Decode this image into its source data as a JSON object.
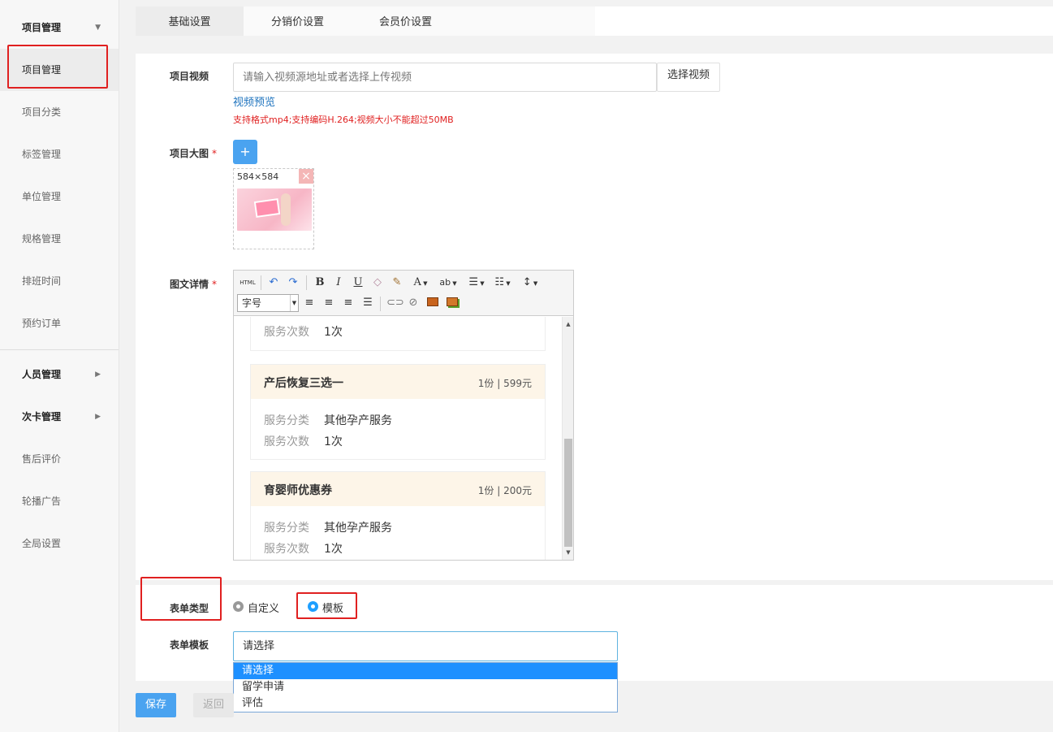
{
  "sidebar": {
    "group1": "项目管理",
    "items": [
      "项目管理",
      "项目分类",
      "标签管理",
      "单位管理",
      "规格管理",
      "排班时间",
      "预约订单"
    ],
    "group2": "人员管理",
    "group3": "次卡管理",
    "items2": [
      "售后评价",
      "轮播广告",
      "全局设置"
    ]
  },
  "tabs": [
    "基础设置",
    "分销价设置",
    "会员价设置"
  ],
  "video": {
    "label": "项目视频",
    "placeholder": "请输入视频源地址或者选择上传视频",
    "button": "选择视频",
    "preview_link": "视频预览",
    "hint": "支持格式mp4;支持编码H.264;视频大小不能超过50MB"
  },
  "image": {
    "label": "项目大图",
    "required": "*",
    "add": "+",
    "size": "584×584",
    "close": "×"
  },
  "detail": {
    "label": "图文详情",
    "required": "*",
    "toolbar": {
      "html": "HTML",
      "bold": "B",
      "italic": "I",
      "underline": "U",
      "font_color": "A",
      "font_size": "字号"
    },
    "packages": [
      {
        "title": "",
        "price": "",
        "rows": [
          {
            "k": "服务次数",
            "v": "1次"
          }
        ]
      },
      {
        "title": "产后恢复三选一",
        "price": "1份 | 599元",
        "rows": [
          {
            "k": "服务分类",
            "v": "其他孕产服务"
          },
          {
            "k": "服务次数",
            "v": "1次"
          }
        ]
      },
      {
        "title": "育婴师优惠券",
        "price": "1份 | 200元",
        "rows": [
          {
            "k": "服务分类",
            "v": "其他孕产服务"
          },
          {
            "k": "服务次数",
            "v": "1次"
          }
        ]
      }
    ]
  },
  "form_type": {
    "label": "表单类型",
    "options": [
      "自定义",
      "模板"
    ],
    "selected": "模板"
  },
  "form_template": {
    "label": "表单模板",
    "value": "请选择",
    "options": [
      "请选择",
      "留学申请",
      "评估"
    ],
    "highlighted": "请选择"
  },
  "actions": {
    "save": "保存",
    "back": "返回"
  },
  "colors": {
    "primary": "#4aa3f0",
    "danger": "#e02020",
    "link": "#1e73be",
    "package_header": "#fdf5e8"
  }
}
